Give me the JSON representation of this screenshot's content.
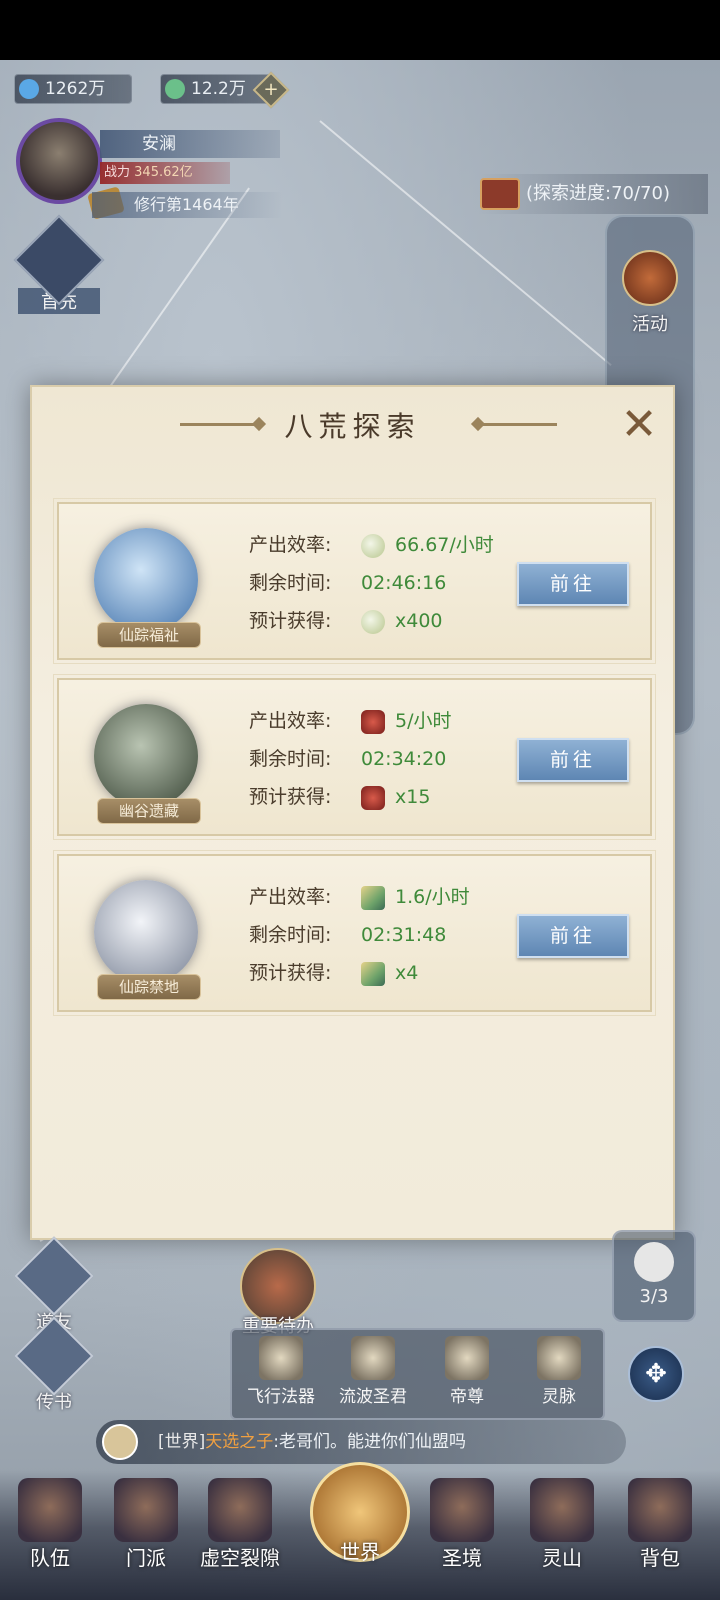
{
  "currencies": [
    {
      "value": "1262万",
      "icon": "spirit-crystal-icon",
      "color": "#5aa8e6"
    },
    {
      "value": "12.2万",
      "icon": "jade-icon",
      "color": "#6bc08a"
    }
  ],
  "player": {
    "name": "安澜",
    "power_label": "战力",
    "power_value": "345.62亿",
    "cultivation": "修行第1464年",
    "leader_label": "首充"
  },
  "explore_progress": "(探索进度:70/70)",
  "right_rail": {
    "activity_label": "活动"
  },
  "modal": {
    "title": "八荒探索",
    "close_icon": "close-icon",
    "labels": {
      "rate": "产出效率:",
      "remaining": "剩余时间:",
      "expected": "预计获得:"
    },
    "cards": [
      {
        "name": "仙踪福祉",
        "rate": "66.67/小时",
        "remaining": "02:46:16",
        "expected": "x400",
        "resource_icon": "cloud-essence-icon",
        "orb_colors": [
          "#cfe4f6",
          "#5a86b8"
        ],
        "button": "前往"
      },
      {
        "name": "幽谷遗藏",
        "rate": "5/小时",
        "remaining": "02:34:20",
        "expected": "x15",
        "resource_icon": "meat-icon",
        "orb_colors": [
          "#b9c4b2",
          "#4e5a4a"
        ],
        "button": "前往"
      },
      {
        "name": "仙踪禁地",
        "rate": "1.6/小时",
        "remaining": "02:31:48",
        "expected": "x4",
        "resource_icon": "fan-icon",
        "orb_colors": [
          "#f2f4f8",
          "#8e96a6"
        ],
        "button": "前往"
      }
    ]
  },
  "hud": {
    "daoyou": "道友",
    "chuanshu": "传书",
    "todo": "重要待办",
    "counter": "3/3",
    "skills": [
      "飞行法器",
      "流波圣君",
      "帝尊",
      "灵脉"
    ]
  },
  "chat": {
    "channel": "[世界]",
    "sender": "天选之子",
    "message": ":老哥们。能进你们仙盟吗"
  },
  "nav": [
    "队伍",
    "门派",
    "虚空裂隙",
    "世界",
    "圣境",
    "灵山",
    "背包"
  ]
}
